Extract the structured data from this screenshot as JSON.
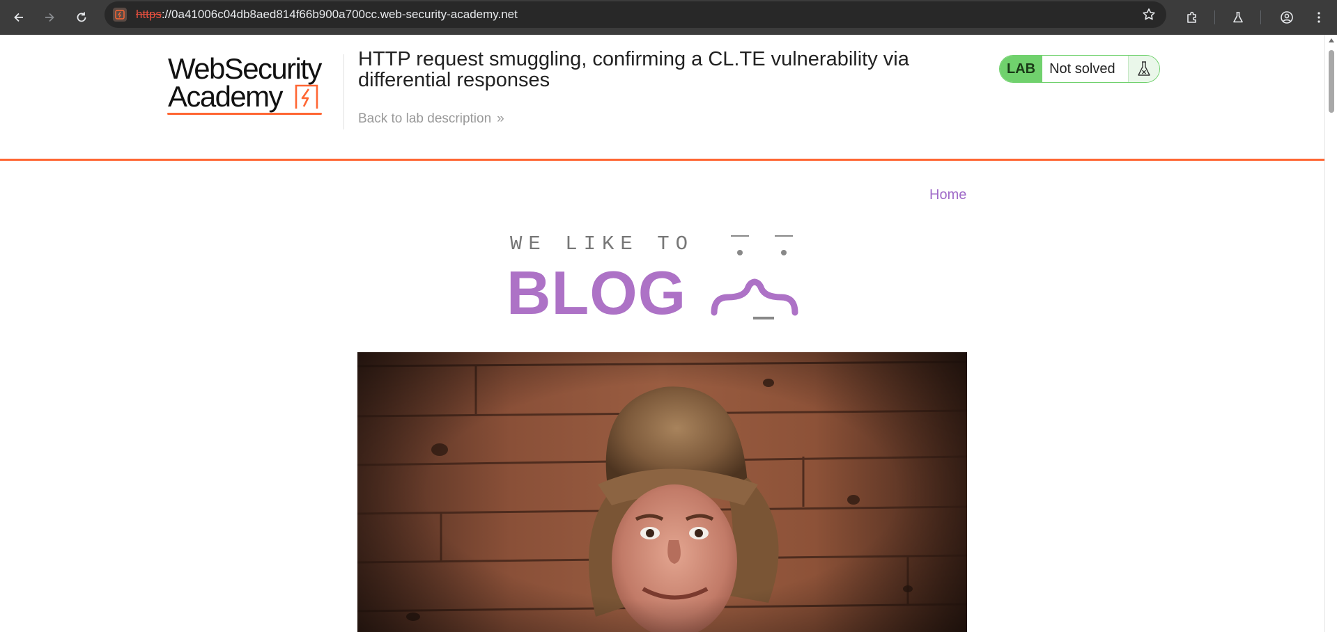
{
  "browser": {
    "url_scheme": "https",
    "url_rest": "://0a41006c04db8aed814f66b900a700cc.web-security-academy.net",
    "icons": [
      "back-icon",
      "forward-icon",
      "reload-icon",
      "site-info-icon",
      "bookmark-star-icon",
      "extensions-icon",
      "labs-flask-icon",
      "profile-icon",
      "more-menu-icon"
    ]
  },
  "header": {
    "logo_line1": "WebSecurity",
    "logo_line2": "Academy",
    "lab_title": "HTTP request smuggling, confirming a CL.TE vulnerability via differential responses",
    "back_link": "Back to lab description",
    "back_chevron": "»",
    "status_tag": "LAB",
    "status_text": "Not solved",
    "accent_color": "#ff6633",
    "status_color": "#70d16d"
  },
  "nav": {
    "home": "Home",
    "link_color": "#a06bc9"
  },
  "banner": {
    "line1": "WE LIKE TO",
    "line2": "BLOG"
  },
  "hero": {
    "alt": "man in fur hat"
  }
}
